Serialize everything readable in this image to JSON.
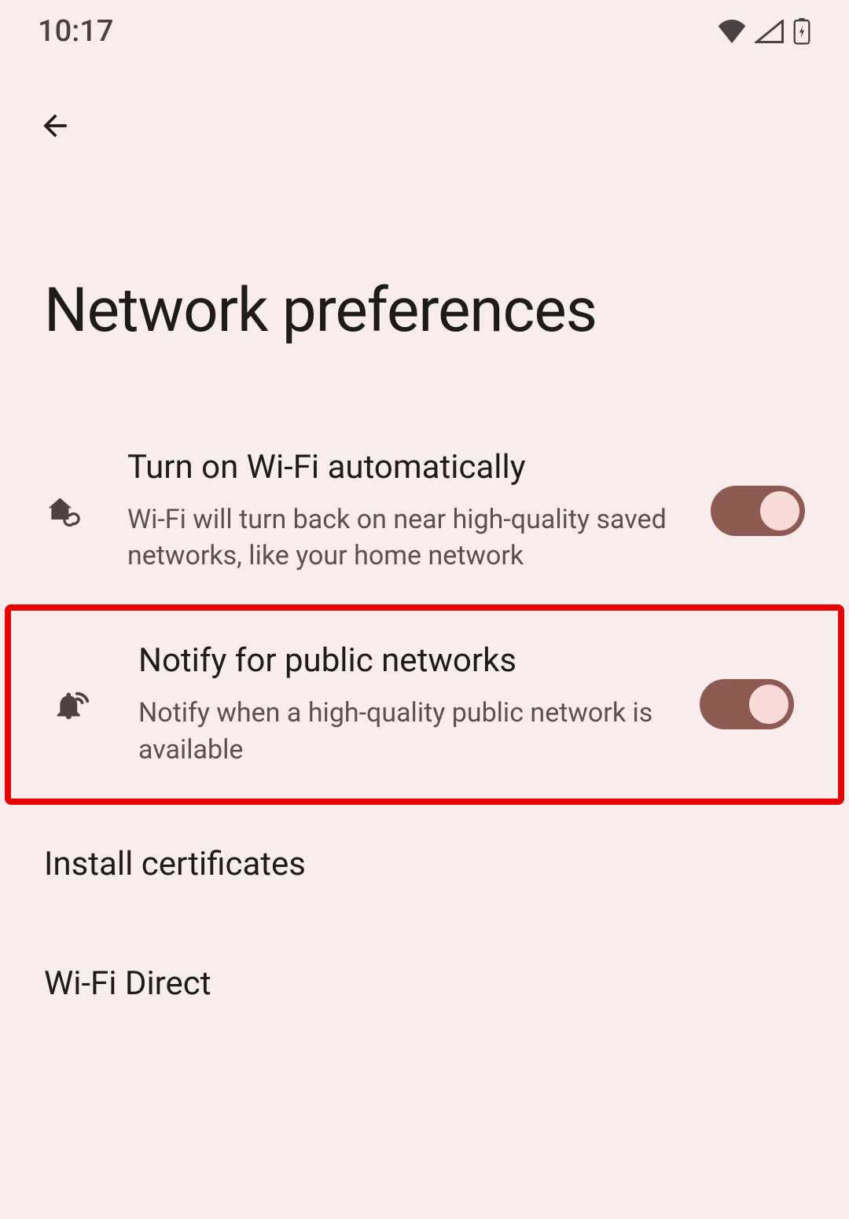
{
  "statusBar": {
    "time": "10:17"
  },
  "header": {
    "title": "Network preferences"
  },
  "settings": [
    {
      "title": "Turn on Wi‑Fi automatically",
      "subtitle": "Wi‑Fi will turn back on near high‑quality saved networks, like your home network",
      "toggled": true
    },
    {
      "title": "Notify for public networks",
      "subtitle": "Notify when a high‑quality public network is available",
      "toggled": true
    },
    {
      "title": "Install certificates"
    },
    {
      "title": "Wi‑Fi Direct"
    }
  ]
}
